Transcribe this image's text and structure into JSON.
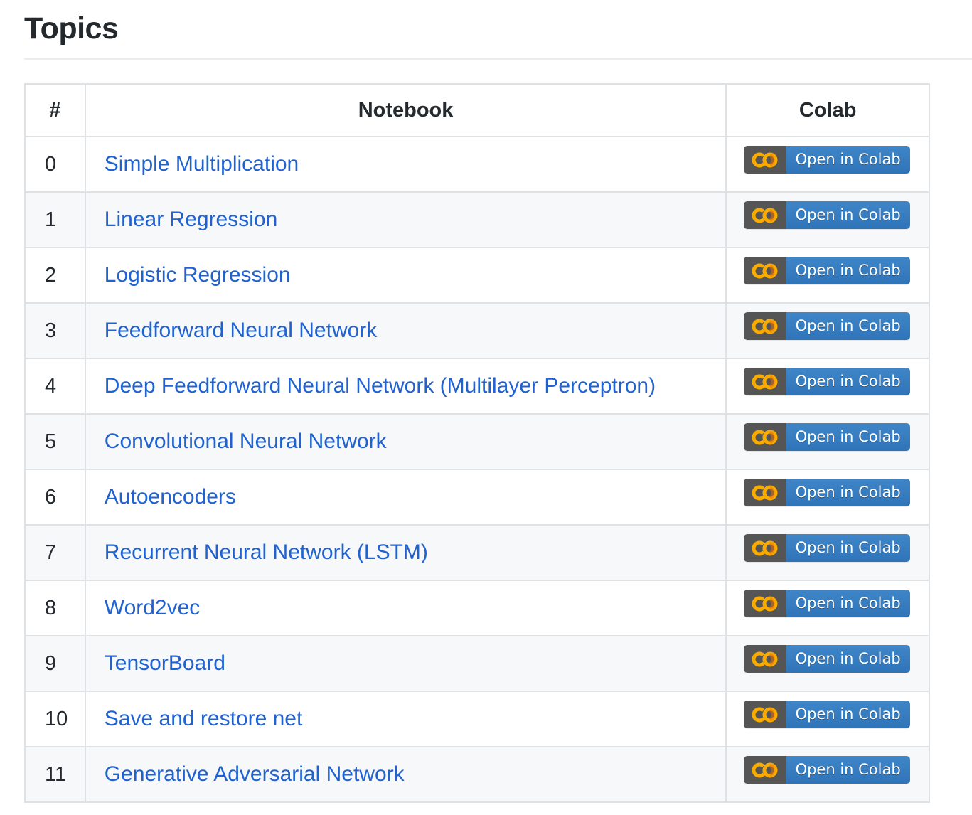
{
  "page": {
    "heading": "Topics"
  },
  "table": {
    "headers": [
      "#",
      "Notebook",
      "Colab"
    ],
    "badge": {
      "icon": "colab-logo-icon",
      "label": "Open in Colab",
      "colors": {
        "logo_bg": "#555555",
        "label_bg": "#3377b8",
        "logo_orange": "#f9ab00"
      }
    },
    "rows": [
      {
        "num": "0",
        "notebook": "Simple Multiplication"
      },
      {
        "num": "1",
        "notebook": "Linear Regression"
      },
      {
        "num": "2",
        "notebook": "Logistic Regression"
      },
      {
        "num": "3",
        "notebook": "Feedforward Neural Network"
      },
      {
        "num": "4",
        "notebook": "Deep Feedforward Neural Network (Multilayer Perceptron)"
      },
      {
        "num": "5",
        "notebook": "Convolutional Neural Network"
      },
      {
        "num": "6",
        "notebook": "Autoencoders"
      },
      {
        "num": "7",
        "notebook": "Recurrent Neural Network (LSTM)"
      },
      {
        "num": "8",
        "notebook": "Word2vec"
      },
      {
        "num": "9",
        "notebook": "TensorBoard"
      },
      {
        "num": "10",
        "notebook": "Save and restore net"
      },
      {
        "num": "11",
        "notebook": "Generative Adversarial Network"
      }
    ]
  },
  "colors": {
    "link": "#1f62d0",
    "text": "#24292e",
    "border": "#dfe2e5",
    "stripe": "#f6f8fa"
  }
}
